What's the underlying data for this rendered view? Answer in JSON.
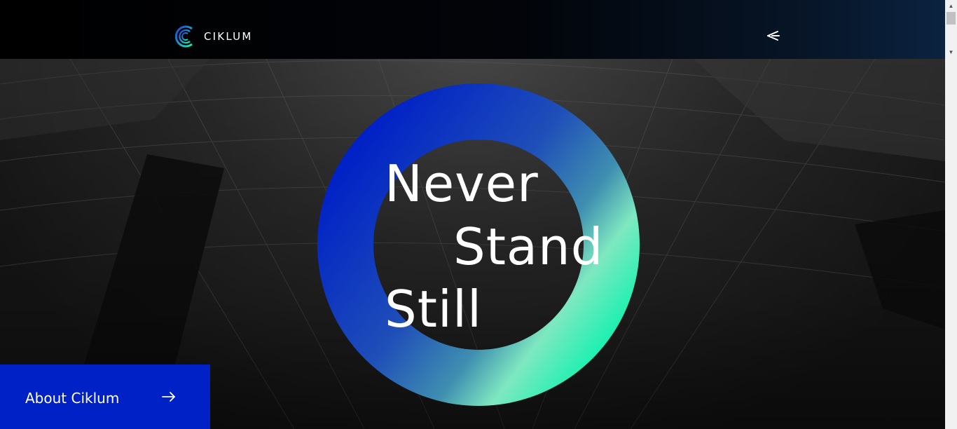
{
  "header": {
    "brand": "CIKLUM",
    "logo_icon": "ciklum-logo-icon",
    "menu_icon": "menu-icon"
  },
  "hero": {
    "headline_line1": "Never",
    "headline_line2": "Stand",
    "headline_line3": "Still",
    "ring_gradient": [
      "#0021c6",
      "#1f4fb8",
      "#3f8fb0",
      "#7ee8c0",
      "#16f1b0"
    ]
  },
  "cta": {
    "label": "About Ciklum",
    "arrow_icon": "arrow-right-icon",
    "background": "#0021c6"
  },
  "scrollbar": {
    "up_icon": "scroll-up-icon",
    "down_icon": "scroll-down-icon"
  }
}
